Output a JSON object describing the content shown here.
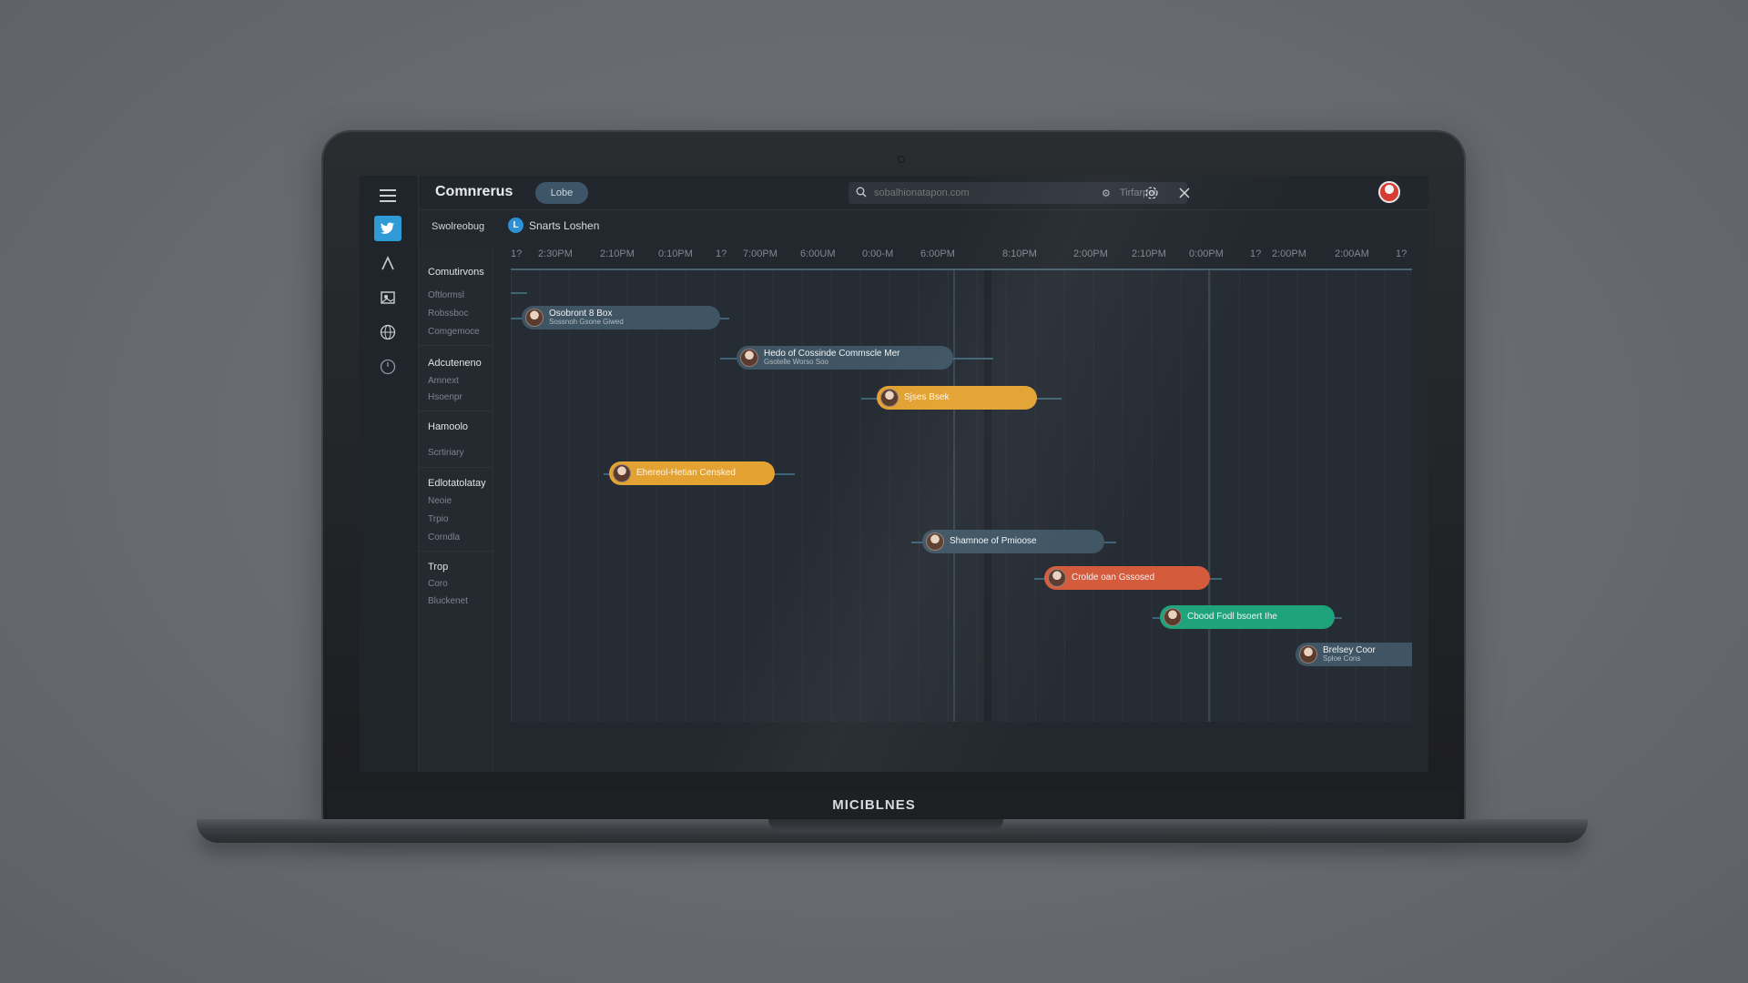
{
  "device": {
    "brand": "MICIBLNES"
  },
  "app": {
    "title": "Comnrerus",
    "top_button": "Lobe",
    "search": {
      "value": "",
      "placeholder": "sobalhionatapon.com",
      "meta": "Tirfarpet"
    }
  },
  "subbar": {
    "left_label": "Swolreobug",
    "tag_letter": "L",
    "tag_label": "Snarts Loshen"
  },
  "rail": {
    "icons": [
      "twitter-icon",
      "triangle-icon",
      "image-icon",
      "globe-icon",
      "clock-icon"
    ]
  },
  "sidebar": {
    "groups": [
      {
        "title": "Comutirvons",
        "items": [
          "Oftlormsl",
          "Robssboc",
          "Comgemoce"
        ]
      },
      {
        "title": "Adcuteneno",
        "items": [
          "Amnext",
          "Hsoenpr"
        ]
      },
      {
        "title": "Hamoolo",
        "items": [
          "Scrtiriary"
        ]
      },
      {
        "title": "Edlotatolatay",
        "items": [
          "Neoie",
          "Trpio",
          "Corndla"
        ]
      },
      {
        "title": "Trop",
        "items": [
          "Coro",
          "Bluckenet"
        ]
      }
    ]
  },
  "timeline": {
    "ticks": [
      "1?",
      "2:30PM",
      "2:10PM",
      "0:10PM",
      "1?",
      "7:00PM",
      "6:00UM",
      "0:00-M",
      "6:00PM",
      "8:10PM",
      "2:00PM",
      "2:10PM",
      "0:00PM",
      "1?",
      "2:00PM",
      "2:00AM",
      "1?"
    ],
    "tasks": [
      {
        "title": "Osobront 8 Box",
        "subtitle": "Sossnoh Gsone Giwed",
        "color": "slate"
      },
      {
        "title": "Hedo of Cossinde Commscle Mer",
        "subtitle": "Gsotelle Worso Soo",
        "color": "slate"
      },
      {
        "title": "Sjses Bsek",
        "subtitle": "",
        "color": "orange"
      },
      {
        "title": "Ehereol-Hetian Censked",
        "subtitle": "",
        "color": "orange"
      },
      {
        "title": "Shamnoe of Pmioose",
        "subtitle": "",
        "color": "slate"
      },
      {
        "title": "Crolde oan Gssosed",
        "subtitle": "",
        "color": "coral"
      },
      {
        "title": "Cbood Fodl bsoert Ihe",
        "subtitle": "",
        "color": "green"
      },
      {
        "title": "Brelsey Coor",
        "subtitle": "Sploe Cons",
        "color": "slate"
      }
    ]
  },
  "colors": {
    "slate": "#3f5563",
    "orange": "#e3a232",
    "coral": "#d45b3c",
    "green": "#1fa37a",
    "accent": "#2e9ad6"
  }
}
